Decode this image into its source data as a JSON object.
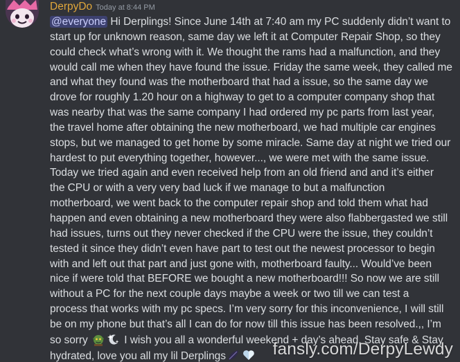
{
  "message": {
    "author": {
      "username": "DerpyDo",
      "username_color": "#e0a73b",
      "avatar_icon": "avatar-icon"
    },
    "timestamp": "Today at 8:44 PM",
    "mention": "@everyone",
    "lines": [
      " Hi Derplings! Since June 14th at 7:40 am my PC suddenly didn’t want to",
      "start up for unknown reason, same day we left it at Computer Repair Shop, so they",
      "could check what’s wrong with it. We thought the rams had a malfunction, and they",
      "would call me when they have found the issue. Friday the same week, they called me",
      "and what they found was the motherboard that had a issue, so the same day we",
      "drove for roughly 1.20 hour on a highway to get to a computer company shop that",
      "was nearby that was the same company I had ordered my pc parts from last year,",
      "the travel home after obtaining the new motherboard, we had multiple car engines",
      "stops, but we managed to get home by some miracle. Same day at night we tried our",
      "hardest to put everything together, however..., we were met with the same issue.",
      "Today we tried again and even received help from an old friend and and it’s either",
      "the CPU or with a very very bad luck if we manage to but a malfunction",
      "motherboard, we went back to the computer repair shop and told them what had",
      "happen and even obtaining a new motherboard they were also flabbergasted we still",
      "had issues, turns out they never checked if the CPU were the issue, they couldn’t",
      "tested it since they didn’t even have part to test out the newest processor to begin",
      "with and left out that part and just gone with, motherboard faulty... Would’ve been",
      "nice if were told that BEFORE we bought a new motherboard!!! So now we are still",
      "without a PC for the next couple days maybe a week or two till we can test a",
      "process that works with my pc specs. I’m very sorry for this inconvenience, I will still",
      "be on my phone but that’s all I can do for now till this issue has been resolved.,, I’m"
    ],
    "line22_before": "so sorry ",
    "line22_after": " I wish you all a wonderful weekend + day’s ahead. Stay safe & Stay",
    "line23": "hydrated, love you all my lil Derplings",
    "emojis": [
      "goblin-emoji-icon",
      "sparkle-moon-emoji-icon",
      "leaf-emoji-icon",
      "white-heart-emoji-icon"
    ],
    "mention_color": "#5865f2"
  },
  "watermark": "fansly.com/DerpyLewdy"
}
